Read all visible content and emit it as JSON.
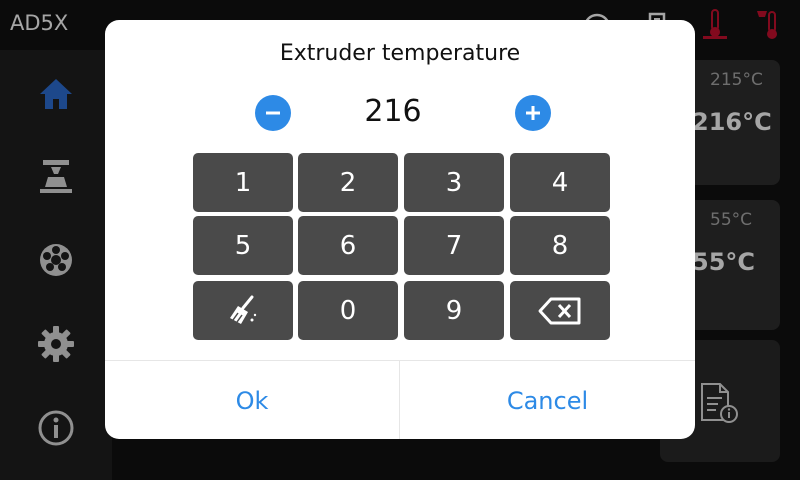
{
  "topbar": {
    "device_name": "AD5X",
    "icons": [
      "status-circle-icon",
      "filament-box-icon",
      "extruder-temp-icon",
      "bed-temp-icon"
    ],
    "alert_color": "#c8102e"
  },
  "sidebar": {
    "items": [
      {
        "icon": "home-icon",
        "active": true
      },
      {
        "icon": "print-icon",
        "active": false
      },
      {
        "icon": "filament-spool-icon",
        "active": false
      },
      {
        "icon": "settings-icon",
        "active": false
      },
      {
        "icon": "info-icon",
        "active": false
      }
    ],
    "accent": "#2d6fd6"
  },
  "cards": {
    "extruder": {
      "target": "215°C",
      "current": "216°C"
    },
    "bed": {
      "target": "55°C",
      "current": "55°C"
    }
  },
  "dialog": {
    "title": "Extruder temperature",
    "value": "216",
    "keys": [
      "1",
      "2",
      "3",
      "4",
      "5",
      "6",
      "7",
      "8",
      "clear",
      "0",
      "9",
      "backspace"
    ],
    "ok_label": "Ok",
    "cancel_label": "Cancel",
    "accent": "#2d8ae6"
  }
}
